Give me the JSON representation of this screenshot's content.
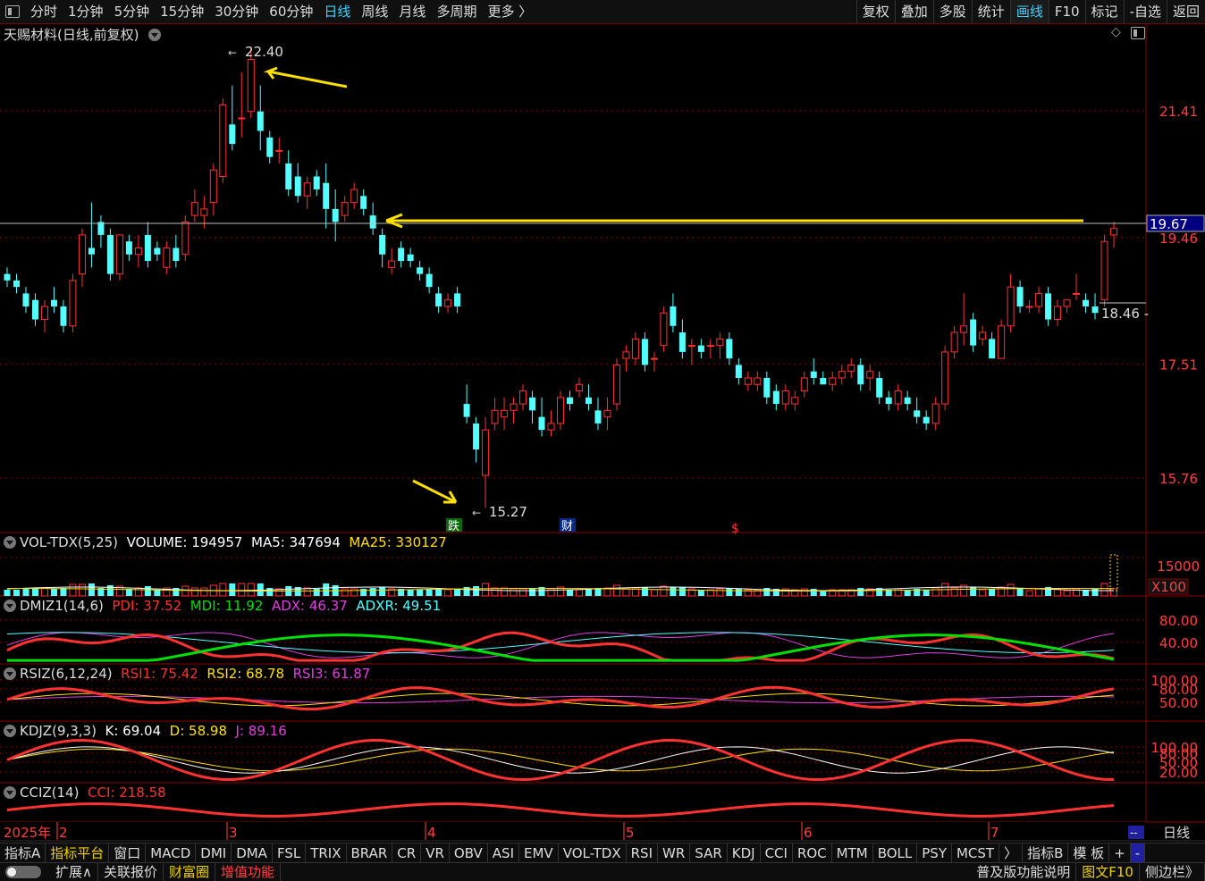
{
  "toolbar": {
    "periods": [
      "分时",
      "1分钟",
      "5分钟",
      "15分钟",
      "30分钟",
      "60分钟",
      "日线",
      "周线",
      "月线",
      "多周期",
      "更多 〉"
    ],
    "active_period": "日线",
    "right": [
      "复权",
      "叠加",
      "多股",
      "统计",
      "画线",
      "F10",
      "标记",
      "-自选",
      "返回"
    ],
    "right_highlight": "画线"
  },
  "main": {
    "title": "天赐材料(日线,前复权)",
    "price_labels": [
      "21.41",
      "19.46",
      "17.51",
      "15.76"
    ],
    "current_price": "19.67",
    "high_label": "22.40",
    "low_label": "15.27",
    "last_close_label": "18.46",
    "markers": [
      "跌",
      "财",
      "$"
    ]
  },
  "volume": {
    "name": "VOL-TDX(5,25)",
    "volume": "VOLUME: 194957",
    "ma5": "MA5: 347694",
    "ma25": "MA25: 330127",
    "scale": "15000",
    "unit": "X100"
  },
  "dmi": {
    "name": "DMIZ1(14,6)",
    "pdi": "PDI: 37.52",
    "mdi": "MDI: 11.92",
    "adx": "ADX: 46.37",
    "adxr": "ADXR: 49.51",
    "ticks": [
      "80.00",
      "40.00"
    ]
  },
  "rsi": {
    "name": "RSIZ(6,12,24)",
    "rsi1": "RSI1: 75.42",
    "rsi2": "RSI2: 68.78",
    "rsi3": "RSI3: 61.87",
    "ticks": [
      "100.00",
      "80.00",
      "50.00"
    ]
  },
  "kdj": {
    "name": "KDJZ(9,3,3)",
    "k": "K: 69.04",
    "d": "D: 58.98",
    "j": "J: 89.16",
    "ticks": [
      "100.00",
      "80.00",
      "50.00",
      "20.00"
    ]
  },
  "cci": {
    "name": "CCIZ(14)",
    "cci": "CCI: 218.58"
  },
  "xaxis": {
    "year": "2025年",
    "months": [
      "2",
      "3",
      "4",
      "5",
      "6",
      "7"
    ],
    "right_label": "日线",
    "dash": "--"
  },
  "bottom_tabs": [
    "指标A",
    "指标平台",
    "窗口",
    "MACD",
    "DMI",
    "DMA",
    "FSL",
    "TRIX",
    "BRAR",
    "CR",
    "VR",
    "OBV",
    "ASI",
    "EMV",
    "VOL-TDX",
    "RSI",
    "WR",
    "SAR",
    "KDJ",
    "CCI",
    "ROC",
    "MTM",
    "BOLL",
    "PSY",
    "MCST",
    "〉",
    "指标B",
    "模 板",
    "+",
    "-"
  ],
  "bottom_tabs_highlight": "指标平台",
  "status": [
    "扩展∧",
    "关联报价",
    "财富圈",
    "增值功能"
  ],
  "status_right": [
    "普及版功能说明",
    "图文F10",
    "侧边栏》"
  ],
  "colors": {
    "up": "#ff3232",
    "down": "#54ffff",
    "grid": "#8a0000",
    "yellow": "#ffe000",
    "green": "#00e000",
    "magenta": "#e040e0"
  },
  "chart_data": {
    "type": "candlestick",
    "title": "天赐材料(日线,前复权)",
    "ylim": [
      15.0,
      23.0
    ],
    "ohlc": [
      [
        18.9,
        19.0,
        18.7,
        18.8
      ],
      [
        18.8,
        18.9,
        18.6,
        18.7
      ],
      [
        18.6,
        18.7,
        18.3,
        18.4
      ],
      [
        18.5,
        18.6,
        18.1,
        18.2
      ],
      [
        18.2,
        18.5,
        18.0,
        18.4
      ],
      [
        18.5,
        18.7,
        18.3,
        18.4
      ],
      [
        18.4,
        18.5,
        18.0,
        18.1
      ],
      [
        18.1,
        18.9,
        18.0,
        18.8
      ],
      [
        18.9,
        19.6,
        18.7,
        19.5
      ],
      [
        19.3,
        20.0,
        19.0,
        19.2
      ],
      [
        19.7,
        19.8,
        19.3,
        19.5
      ],
      [
        19.5,
        19.6,
        18.8,
        18.9
      ],
      [
        18.9,
        19.5,
        18.8,
        19.5
      ],
      [
        19.4,
        19.5,
        19.1,
        19.2
      ],
      [
        19.2,
        19.5,
        19.0,
        19.3
      ],
      [
        19.5,
        19.7,
        19.0,
        19.1
      ],
      [
        19.3,
        19.4,
        19.1,
        19.2
      ],
      [
        19.0,
        19.4,
        18.9,
        19.3
      ],
      [
        19.3,
        19.5,
        19.0,
        19.1
      ],
      [
        19.2,
        19.8,
        19.1,
        19.7
      ],
      [
        19.8,
        20.2,
        19.7,
        20.0
      ],
      [
        19.8,
        20.1,
        19.6,
        19.9
      ],
      [
        20.0,
        20.6,
        19.8,
        20.5
      ],
      [
        20.4,
        21.6,
        20.3,
        21.5
      ],
      [
        21.2,
        21.8,
        20.8,
        20.9
      ],
      [
        21.3,
        22.0,
        21.0,
        21.3
      ],
      [
        21.4,
        22.4,
        21.3,
        22.2
      ],
      [
        21.4,
        21.8,
        20.8,
        21.1
      ],
      [
        21.0,
        21.1,
        20.6,
        20.7
      ],
      [
        20.8,
        21.0,
        20.6,
        20.8
      ],
      [
        20.6,
        20.8,
        20.1,
        20.2
      ],
      [
        20.4,
        20.6,
        20.0,
        20.1
      ],
      [
        20.1,
        20.4,
        19.9,
        20.3
      ],
      [
        20.4,
        20.5,
        20.1,
        20.2
      ],
      [
        20.3,
        20.6,
        19.6,
        19.9
      ],
      [
        19.9,
        20.2,
        19.4,
        19.7
      ],
      [
        19.8,
        20.1,
        19.7,
        20.0
      ],
      [
        20.0,
        20.3,
        19.9,
        20.2
      ],
      [
        20.1,
        20.2,
        19.8,
        19.9
      ],
      [
        19.8,
        20.0,
        19.5,
        19.6
      ],
      [
        19.5,
        19.6,
        19.0,
        19.2
      ],
      [
        19.0,
        19.3,
        18.9,
        19.1
      ],
      [
        19.3,
        19.4,
        19.0,
        19.1
      ],
      [
        19.2,
        19.3,
        19.0,
        19.1
      ],
      [
        19.0,
        19.1,
        18.8,
        18.9
      ],
      [
        18.9,
        19.0,
        18.6,
        18.7
      ],
      [
        18.6,
        18.7,
        18.3,
        18.4
      ],
      [
        18.4,
        18.6,
        18.3,
        18.5
      ],
      [
        18.6,
        18.7,
        18.3,
        18.4
      ],
      [
        16.9,
        17.2,
        16.6,
        16.7
      ],
      [
        16.6,
        16.7,
        16.0,
        16.2
      ],
      [
        15.8,
        16.7,
        15.3,
        16.5
      ],
      [
        16.6,
        17.0,
        16.5,
        16.8
      ],
      [
        16.7,
        17.0,
        16.5,
        16.8
      ],
      [
        16.8,
        17.0,
        16.6,
        16.9
      ],
      [
        16.9,
        17.2,
        16.8,
        17.1
      ],
      [
        17.0,
        17.1,
        16.6,
        16.8
      ],
      [
        16.7,
        17.0,
        16.4,
        16.5
      ],
      [
        16.5,
        16.8,
        16.4,
        16.6
      ],
      [
        16.6,
        17.1,
        16.5,
        17.0
      ],
      [
        17.0,
        17.1,
        16.8,
        16.9
      ],
      [
        17.1,
        17.3,
        17.0,
        17.2
      ],
      [
        17.0,
        17.2,
        16.8,
        16.9
      ],
      [
        16.8,
        17.0,
        16.5,
        16.6
      ],
      [
        16.7,
        17.0,
        16.5,
        16.8
      ],
      [
        16.9,
        17.6,
        16.8,
        17.5
      ],
      [
        17.6,
        17.8,
        17.4,
        17.7
      ],
      [
        17.6,
        18.0,
        17.5,
        17.9
      ],
      [
        17.9,
        18.0,
        17.4,
        17.5
      ],
      [
        17.6,
        17.7,
        17.4,
        17.6
      ],
      [
        17.8,
        18.4,
        17.7,
        18.3
      ],
      [
        18.4,
        18.6,
        18.0,
        18.1
      ],
      [
        18.0,
        18.2,
        17.6,
        17.7
      ],
      [
        17.8,
        17.9,
        17.5,
        17.8
      ],
      [
        17.8,
        17.9,
        17.6,
        17.7
      ],
      [
        17.8,
        17.9,
        17.6,
        17.8
      ],
      [
        17.8,
        18.0,
        17.6,
        17.9
      ],
      [
        17.9,
        18.0,
        17.5,
        17.6
      ],
      [
        17.5,
        17.6,
        17.2,
        17.3
      ],
      [
        17.2,
        17.4,
        17.1,
        17.3
      ],
      [
        17.2,
        17.4,
        17.1,
        17.3
      ],
      [
        17.3,
        17.4,
        16.9,
        17.0
      ],
      [
        17.1,
        17.2,
        16.8,
        16.9
      ],
      [
        16.9,
        17.2,
        16.8,
        17.1
      ],
      [
        16.9,
        17.1,
        16.8,
        17.0
      ],
      [
        17.1,
        17.4,
        17.0,
        17.3
      ],
      [
        17.4,
        17.6,
        17.2,
        17.3
      ],
      [
        17.3,
        17.4,
        17.2,
        17.2
      ],
      [
        17.2,
        17.4,
        17.1,
        17.3
      ],
      [
        17.3,
        17.5,
        17.2,
        17.4
      ],
      [
        17.4,
        17.6,
        17.3,
        17.5
      ],
      [
        17.5,
        17.6,
        17.1,
        17.2
      ],
      [
        17.3,
        17.5,
        17.1,
        17.4
      ],
      [
        17.3,
        17.4,
        16.9,
        17.0
      ],
      [
        17.0,
        17.1,
        16.8,
        16.9
      ],
      [
        16.9,
        17.2,
        16.8,
        17.1
      ],
      [
        17.0,
        17.1,
        16.8,
        16.9
      ],
      [
        16.8,
        17.0,
        16.6,
        16.7
      ],
      [
        16.7,
        16.8,
        16.5,
        16.6
      ],
      [
        16.6,
        17.0,
        16.5,
        16.9
      ],
      [
        16.9,
        17.8,
        16.8,
        17.7
      ],
      [
        17.7,
        18.1,
        17.6,
        18.0
      ],
      [
        18.0,
        18.6,
        17.8,
        18.1
      ],
      [
        18.2,
        18.3,
        17.7,
        17.8
      ],
      [
        17.9,
        18.1,
        17.8,
        18.0
      ],
      [
        17.9,
        18.0,
        17.6,
        17.6
      ],
      [
        17.6,
        18.2,
        17.6,
        18.1
      ],
      [
        18.1,
        18.9,
        18.0,
        18.7
      ],
      [
        18.7,
        18.8,
        18.3,
        18.4
      ],
      [
        18.4,
        18.5,
        18.3,
        18.4
      ],
      [
        18.4,
        18.7,
        18.3,
        18.6
      ],
      [
        18.6,
        18.7,
        18.1,
        18.2
      ],
      [
        18.2,
        18.5,
        18.1,
        18.4
      ],
      [
        18.4,
        18.5,
        18.3,
        18.5
      ],
      [
        18.6,
        18.9,
        18.5,
        18.6
      ],
      [
        18.5,
        18.6,
        18.3,
        18.4
      ],
      [
        18.4,
        18.6,
        18.2,
        18.3
      ],
      [
        18.5,
        19.5,
        18.4,
        19.4
      ],
      [
        19.5,
        19.7,
        19.3,
        19.6
      ]
    ],
    "volume_ma5": 347694,
    "volume_ma25": 330127,
    "volume_last": 194957
  }
}
